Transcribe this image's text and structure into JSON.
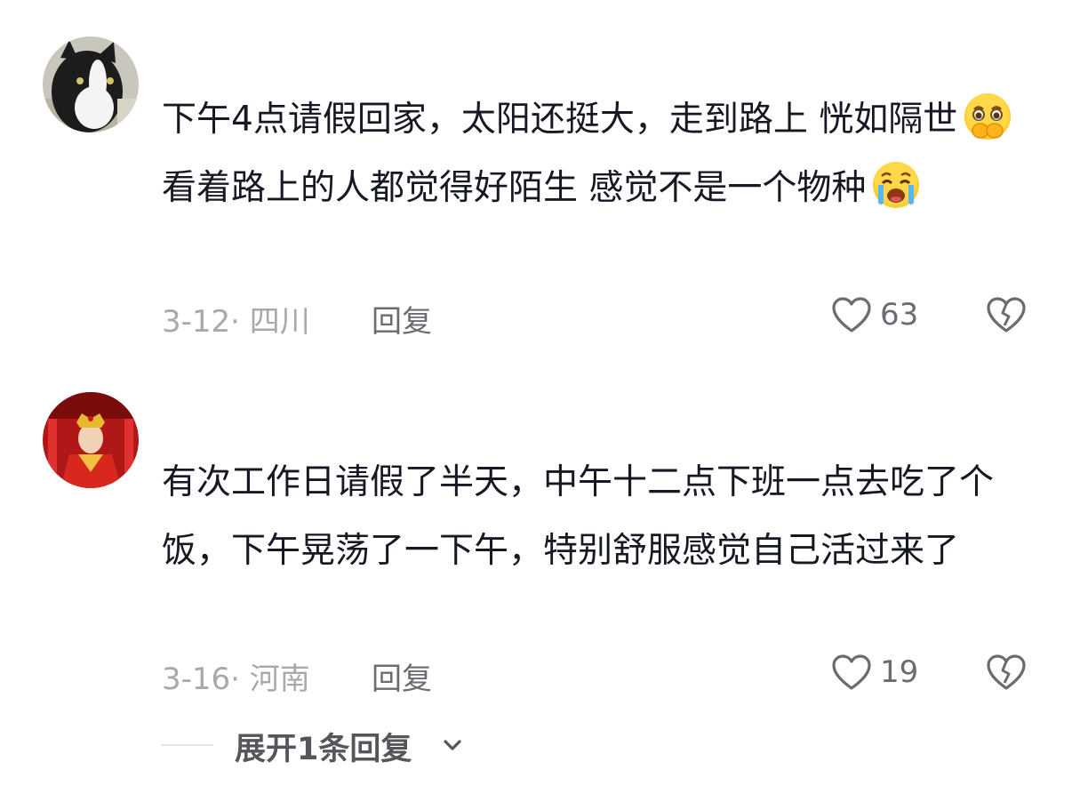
{
  "comments": [
    {
      "avatar": "cat-avatar",
      "segments": [
        "下午4点请假回家，太阳还挺大，走到路上 恍如隔世",
        " 看着路上的人都觉得好陌生 感觉不是一个物种"
      ],
      "emojis": [
        "holding-back-tears-emoji",
        "crying-face-emoji"
      ],
      "date_location": "3-12· 四川",
      "reply_label": "回复",
      "likes": "63"
    },
    {
      "avatar": "red-costume-avatar",
      "text": "有次工作日请假了半天，中午十二点下班一点去吃了个饭，下午晃荡了一下午，特别舒服感觉自己活过来了",
      "date_location": "3-16· 河南",
      "reply_label": "回复",
      "likes": "19"
    }
  ],
  "expand": {
    "label": "展开1条回复"
  },
  "icons": {
    "like": "heart-outline-icon",
    "dislike": "broken-heart-icon",
    "expand": "chevron-down-icon"
  },
  "colors": {
    "text": "#161823",
    "meta": "#a8a9ad",
    "secondary": "#6b6c72"
  }
}
